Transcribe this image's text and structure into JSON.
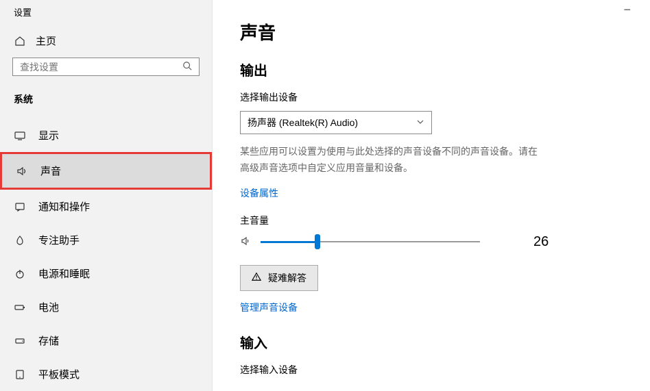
{
  "app_title": "设置",
  "minimize": "−",
  "home_label": "主页",
  "search": {
    "placeholder": "查找设置"
  },
  "category": "系统",
  "nav": {
    "display": "显示",
    "sound": "声音",
    "notifications": "通知和操作",
    "focus": "专注助手",
    "power": "电源和睡眠",
    "battery": "电池",
    "storage": "存储",
    "tablet": "平板模式"
  },
  "page": {
    "heading": "声音",
    "output": {
      "heading": "输出",
      "device_label": "选择输出设备",
      "device_value": "扬声器 (Realtek(R) Audio)",
      "desc": "某些应用可以设置为使用与此处选择的声音设备不同的声音设备。请在高级声音选项中自定义应用音量和设备。",
      "props_link": "设备属性",
      "volume_label": "主音量",
      "volume_value": "26",
      "volume_pct": 26,
      "troubleshoot": "疑难解答",
      "manage_link": "管理声音设备"
    },
    "input": {
      "heading": "输入",
      "device_label": "选择输入设备"
    }
  }
}
